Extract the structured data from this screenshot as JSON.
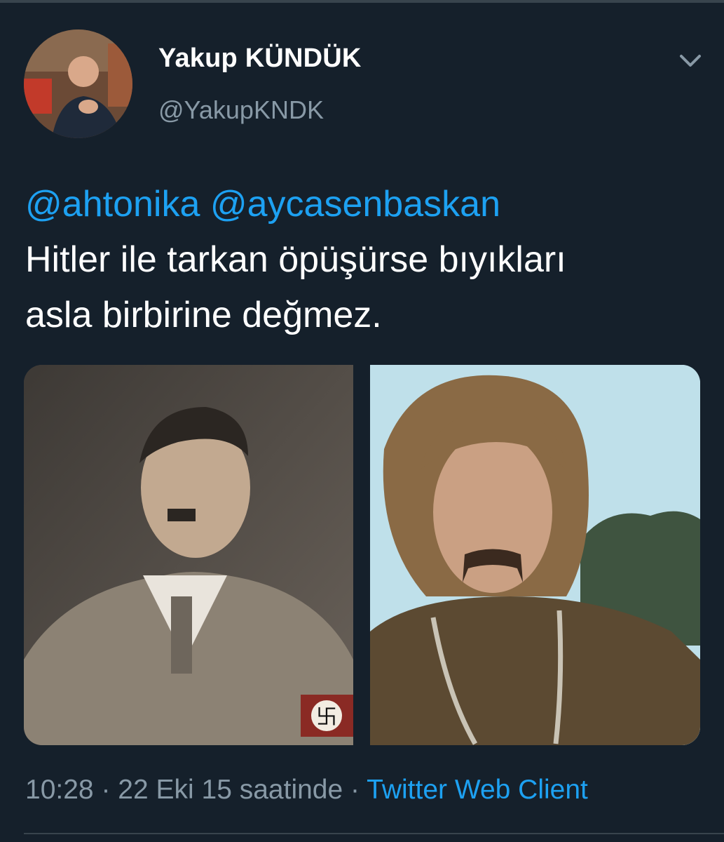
{
  "tweet": {
    "author": {
      "display_name": "Yakup KÜNDÜK",
      "handle": "@YakupKNDK"
    },
    "mentions": [
      "@ahtonika",
      "@aycasenbaskan"
    ],
    "body_lines": [
      "Hitler ile tarkan öpüşürse bıyıkları",
      "asla birbirine değmez."
    ],
    "media": [
      {
        "description": "sepia portrait of a man with a toothbrush mustache in uniform with armband"
      },
      {
        "description": "man with long wavy hair and a horseshoe mustache wearing a chain"
      }
    ],
    "meta": {
      "time": "10:28",
      "separator": " · ",
      "date": "22 Eki 15 saatinde",
      "separator2": " · ",
      "source": "Twitter Web Client"
    },
    "icons": {
      "more": "chevron-down-icon"
    }
  },
  "colors": {
    "background": "#15202b",
    "text": "#ffffff",
    "secondary": "#8899a6",
    "accent": "#1da1f2",
    "divider": "#38444d"
  }
}
